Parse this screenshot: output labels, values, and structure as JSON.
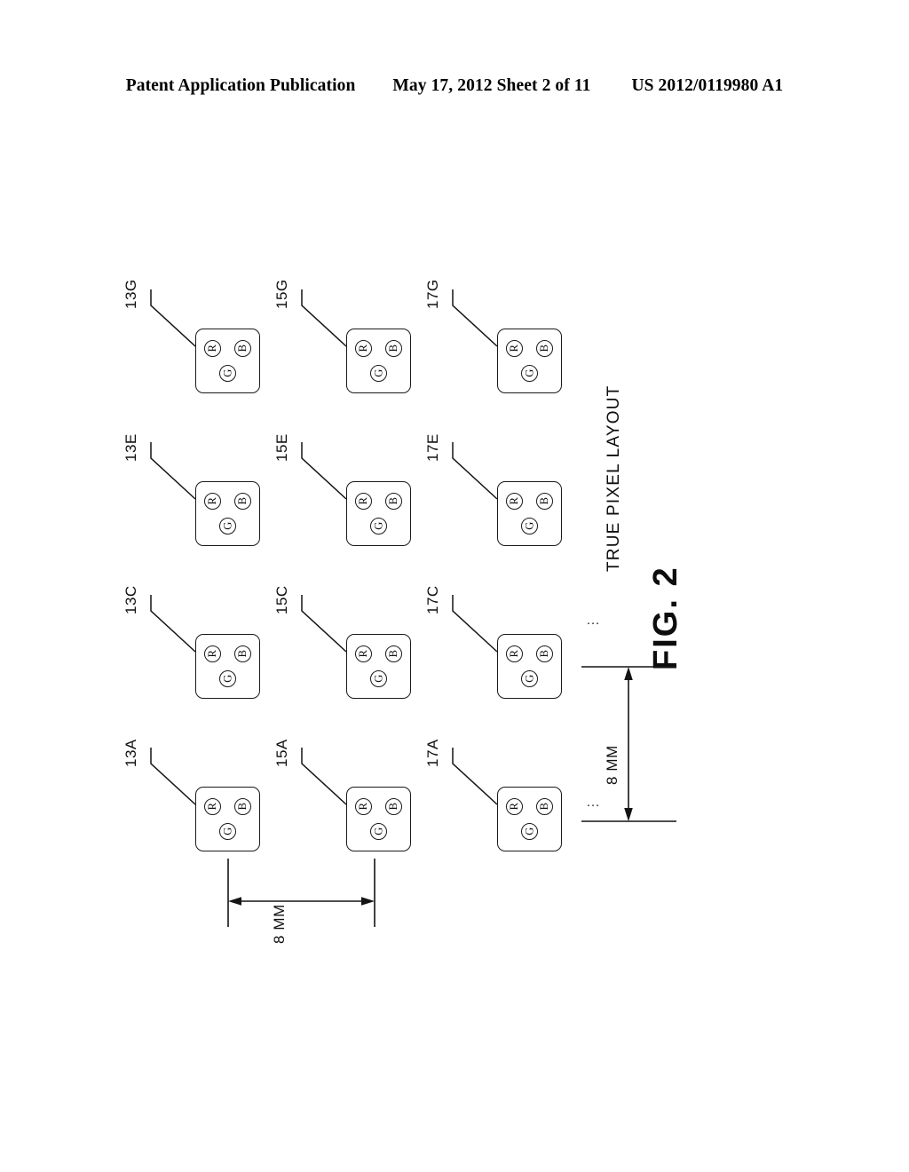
{
  "header": {
    "left": "Patent Application Publication",
    "middle": "May 17, 2012  Sheet 2 of 11",
    "right": "US 2012/0119980 A1"
  },
  "figure": {
    "caption": "FIG. 2",
    "layout_caption": "TRUE PIXEL LAYOUT"
  },
  "subpixel_labels": {
    "red": "R",
    "green": "G",
    "blue": "B"
  },
  "cells": [
    {
      "ref": "13G",
      "col": 0,
      "row": 0
    },
    {
      "ref": "15G",
      "col": 1,
      "row": 0
    },
    {
      "ref": "17G",
      "col": 2,
      "row": 0
    },
    {
      "ref": "13E",
      "col": 0,
      "row": 1
    },
    {
      "ref": "15E",
      "col": 1,
      "row": 1
    },
    {
      "ref": "17E",
      "col": 2,
      "row": 1
    },
    {
      "ref": "13C",
      "col": 0,
      "row": 2
    },
    {
      "ref": "15C",
      "col": 1,
      "row": 2
    },
    {
      "ref": "17C",
      "col": 2,
      "row": 2
    },
    {
      "ref": "13A",
      "col": 0,
      "row": 3
    },
    {
      "ref": "15A",
      "col": 1,
      "row": 3
    },
    {
      "ref": "17A",
      "col": 2,
      "row": 3
    }
  ],
  "dimensions": {
    "vertical_pitch": "8 MM",
    "horizontal_pitch": "8 MM"
  },
  "colors": {
    "ink": "#141414",
    "background": "#ffffff"
  }
}
